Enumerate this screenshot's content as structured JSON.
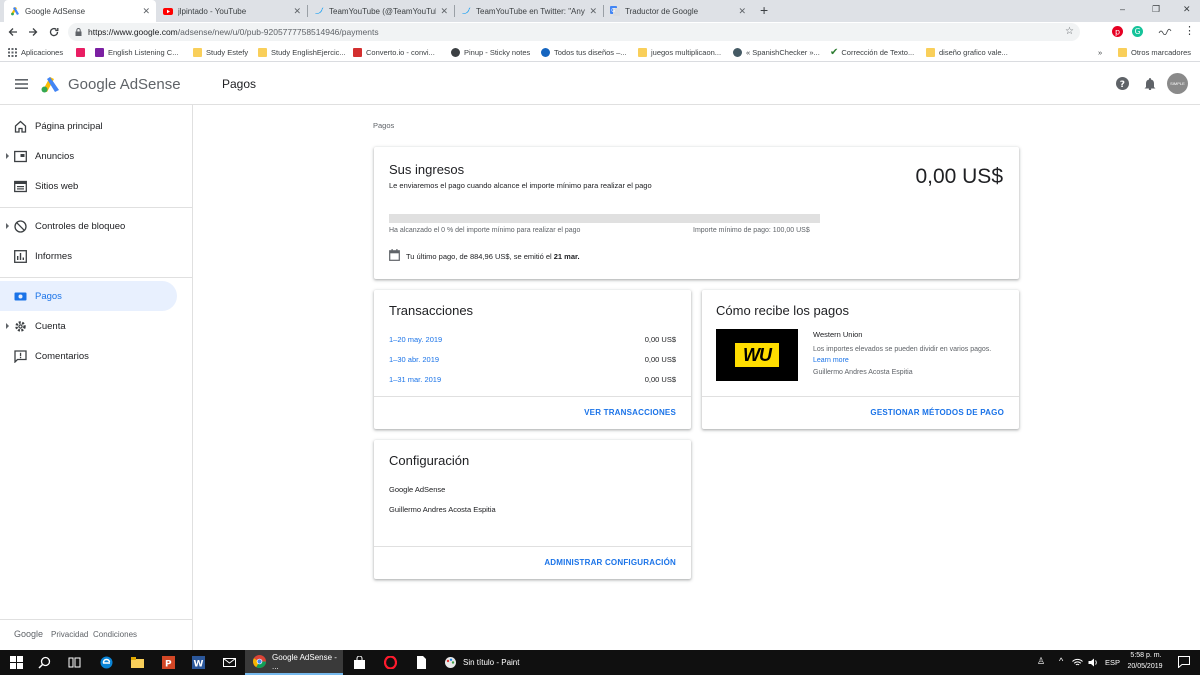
{
  "tabs": [
    {
      "title": "Google AdSense",
      "active": true
    },
    {
      "title": "jlpintado - YouTube",
      "active": false
    },
    {
      "title": "TeamYouTube (@TeamYouTube)",
      "active": false
    },
    {
      "title": "TeamYouTube en Twitter: \"Any n",
      "active": false
    },
    {
      "title": "Traductor de Google",
      "active": false
    }
  ],
  "window": {
    "minimize": "–",
    "restore": "❐",
    "close": "✕",
    "new_tab": "+"
  },
  "address": {
    "prefix": "https://www.google.com",
    "path": "/adsense/new/u/0/pub-9205777758514946/payments"
  },
  "bookmarks": [
    {
      "label": "Aplicaciones",
      "color": "#ea4335"
    },
    {
      "label": "",
      "color": "#e91e63"
    },
    {
      "label": "English Listening C...",
      "color": "#7b1fa2"
    },
    {
      "label": "Study Estefy",
      "color": "#f9cf5a"
    },
    {
      "label": "Study EnglishEjercic...",
      "color": "#f9cf5a"
    },
    {
      "label": "Converto.io - convi...",
      "color": "#d32f2f"
    },
    {
      "label": "Pinup - Sticky notes",
      "color": "#3c4043"
    },
    {
      "label": "Todos tus diseños –...",
      "color": "#1565c0"
    },
    {
      "label": "juegos multiplicaon...",
      "color": "#f9cf5a"
    },
    {
      "label": "« SpanishChecker »...",
      "color": "#455a64"
    },
    {
      "label": "Corrección de Texto...",
      "color": "#2e7d32"
    },
    {
      "label": "diseño grafico vale...",
      "color": "#f9cf5a"
    }
  ],
  "bookmarks_more": "»",
  "bookmarks_other": "Otros marcadores",
  "header": {
    "brand": "Google AdSense",
    "page_title": "Pagos",
    "avatar_text": "SIMPLE"
  },
  "sidebar": {
    "items": [
      {
        "label": "Página principal",
        "icon": "home-icon",
        "expandable": false,
        "active": false
      },
      {
        "label": "Anuncios",
        "icon": "ads-icon",
        "expandable": true,
        "active": false
      },
      {
        "label": "Sitios web",
        "icon": "web-icon",
        "expandable": false,
        "active": false
      },
      {
        "label": "Controles de bloqueo",
        "icon": "block-icon",
        "expandable": true,
        "active": false
      },
      {
        "label": "Informes",
        "icon": "reports-icon",
        "expandable": false,
        "active": false
      },
      {
        "label": "Pagos",
        "icon": "payments-icon",
        "expandable": false,
        "active": true
      },
      {
        "label": "Cuenta",
        "icon": "gear-icon",
        "expandable": true,
        "active": false
      },
      {
        "label": "Comentarios",
        "icon": "feedback-icon",
        "expandable": false,
        "active": false
      }
    ],
    "footer": {
      "google": "Google",
      "privacy": "Privacidad",
      "terms": "Condiciones"
    }
  },
  "breadcrumb": "Pagos",
  "income": {
    "title": "Sus ingresos",
    "subtitle": "Le enviaremos el pago cuando alcance el importe mínimo para realizar el pago",
    "amount": "0,00 US$",
    "progress_fraction": 0,
    "progress_text": "Ha alcanzado el 0 % del importe mínimo para realizar el pago",
    "threshold_text": "Importe mínimo de pago: 100,00 US$",
    "last_payment_a": "Tu último pago, de ",
    "last_payment_amount": "884,96 US$",
    "last_payment_b": ", se emitió el ",
    "last_payment_date": "21 mar."
  },
  "transactions": {
    "title": "Transacciones",
    "rows": [
      {
        "period": "1–20 may. 2019",
        "amount": "0,00 US$"
      },
      {
        "period": "1–30 abr. 2019",
        "amount": "0,00 US$"
      },
      {
        "period": "1–31 mar. 2019",
        "amount": "0,00 US$"
      }
    ],
    "action": "VER TRANSACCIONES"
  },
  "payment_method": {
    "title": "Cómo recibe los pagos",
    "logo_text": "WU",
    "provider": "Western Union",
    "description": "Los importes elevados se pueden dividir en varios pagos.",
    "learn_more": "Learn more",
    "holder": "Guillermo Andres Acosta Espitia",
    "action": "GESTIONAR MÉTODOS DE PAGO"
  },
  "settings": {
    "title": "Configuración",
    "product": "Google AdSense",
    "name": "Guillermo Andres Acosta Espitia",
    "action": "ADMINISTRAR CONFIGURACIÓN"
  },
  "taskbar": {
    "apps": [
      {
        "label": "Google AdSense - ...",
        "icon": "chrome-icon"
      },
      {
        "label": "Sin título - Paint",
        "icon": "paint-icon"
      }
    ],
    "lang": "ESP",
    "time": "5:58 p. m.",
    "date": "20/05/2019"
  },
  "colors": {
    "accent": "#1a73e8",
    "active_nav_bg": "#e8f0fe",
    "wu_yellow": "#ffdd00",
    "wu_black": "#000000"
  }
}
